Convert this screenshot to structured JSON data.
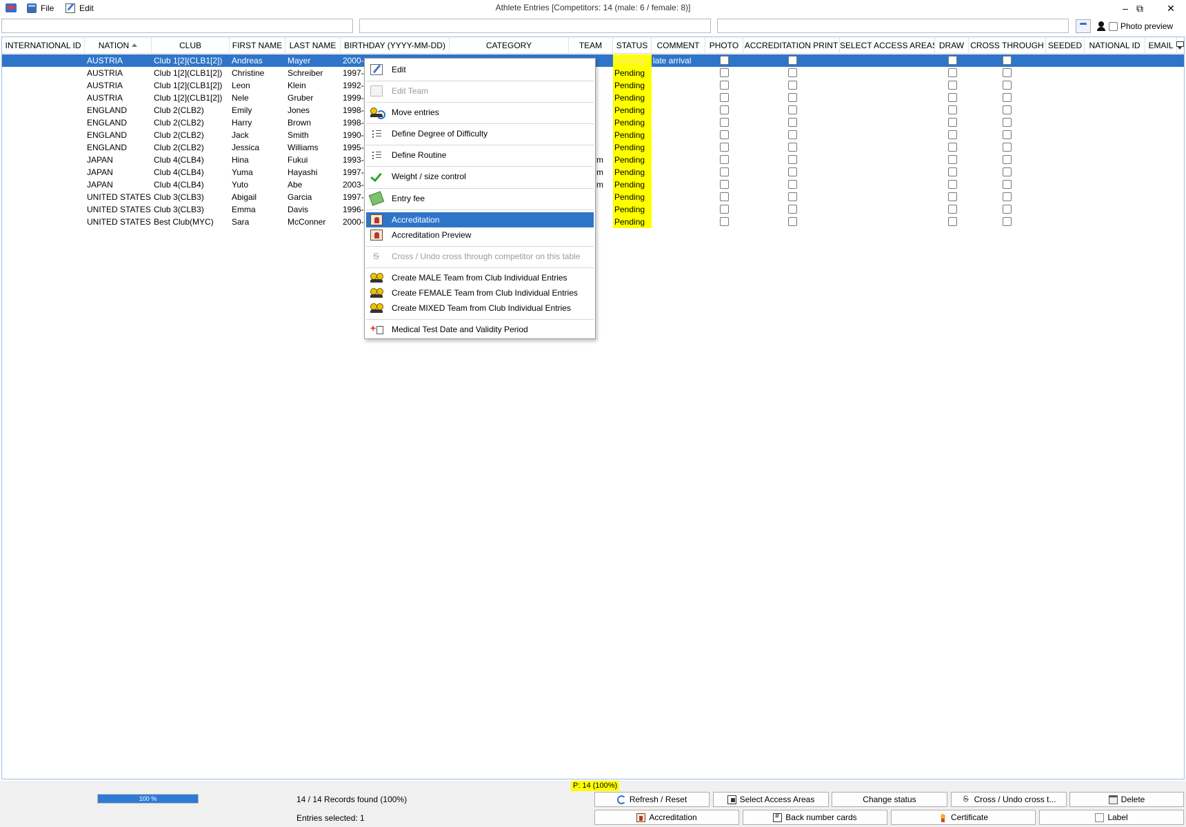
{
  "window": {
    "title": "Athlete Entries [Competitors: 14 (male: 6 / female: 8)]",
    "controls": [
      "–",
      "⧉",
      "✕"
    ]
  },
  "menu": {
    "file": "File",
    "edit": "Edit"
  },
  "toolbar": {
    "photo_preview": "Photo preview"
  },
  "table": {
    "headers": [
      "INTERNATIONAL ID",
      "NATION",
      "CLUB",
      "FIRST NAME",
      "LAST NAME",
      "BIRTHDAY (YYYY-MM-DD)",
      "CATEGORY",
      "TEAM",
      "STATUS",
      "COMMENT",
      "PHOTO",
      "ACCREDITATION PRINT",
      "SELECT ACCESS AREAS",
      "DRAW",
      "CROSS THROUGH",
      "SEEDED",
      "NATIONAL ID",
      "EMAIL"
    ],
    "rows": [
      {
        "nation": "AUSTRIA",
        "club": "Club 1[2](CLB1[2])",
        "first": "Andreas",
        "last": "Mayer",
        "birthday": "2000-",
        "team": "",
        "status": "Pending",
        "comment": "late arrival"
      },
      {
        "nation": "AUSTRIA",
        "club": "Club 1[2](CLB1[2])",
        "first": "Christine",
        "last": "Schreiber",
        "birthday": "1997-0",
        "team": "",
        "status": "Pending",
        "comment": ""
      },
      {
        "nation": "AUSTRIA",
        "club": "Club 1[2](CLB1[2])",
        "first": "Leon",
        "last": "Klein",
        "birthday": "1992-0",
        "team": "",
        "status": "Pending",
        "comment": ""
      },
      {
        "nation": "AUSTRIA",
        "club": "Club 1[2](CLB1[2])",
        "first": "Nele",
        "last": "Gruber",
        "birthday": "1999-0",
        "team": "",
        "status": "Pending",
        "comment": ""
      },
      {
        "nation": "ENGLAND",
        "club": "Club 2(CLB2)",
        "first": "Emily",
        "last": "Jones",
        "birthday": "1998-1",
        "team": "",
        "status": "Pending",
        "comment": ""
      },
      {
        "nation": "ENGLAND",
        "club": "Club 2(CLB2)",
        "first": "Harry",
        "last": "Brown",
        "birthday": "1998-1",
        "team": "",
        "status": "Pending",
        "comment": ""
      },
      {
        "nation": "ENGLAND",
        "club": "Club 2(CLB2)",
        "first": "Jack",
        "last": "Smith",
        "birthday": "1990-0",
        "team": "",
        "status": "Pending",
        "comment": ""
      },
      {
        "nation": "ENGLAND",
        "club": "Club 2(CLB2)",
        "first": "Jessica",
        "last": "Williams",
        "birthday": "1995-0",
        "team": "",
        "status": "Pending",
        "comment": ""
      },
      {
        "nation": "JAPAN",
        "club": "Club 4(CLB4)",
        "first": "Hina",
        "last": "Fukui",
        "birthday": "1993-0",
        "team": "m",
        "status": "Pending",
        "comment": ""
      },
      {
        "nation": "JAPAN",
        "club": "Club 4(CLB4)",
        "first": "Yuma",
        "last": "Hayashi",
        "birthday": "1997-1",
        "team": "m",
        "status": "Pending",
        "comment": ""
      },
      {
        "nation": "JAPAN",
        "club": "Club 4(CLB4)",
        "first": "Yuto",
        "last": "Abe",
        "birthday": "2003-0",
        "team": "m",
        "status": "Pending",
        "comment": ""
      },
      {
        "nation": "UNITED STATES",
        "club": "Club 3(CLB3)",
        "first": "Abigail",
        "last": "Garcia",
        "birthday": "1997-0",
        "team": "",
        "status": "Pending",
        "comment": ""
      },
      {
        "nation": "UNITED STATES",
        "club": "Club 3(CLB3)",
        "first": "Emma",
        "last": "Davis",
        "birthday": "1996-1",
        "team": "",
        "status": "Pending",
        "comment": ""
      },
      {
        "nation": "UNITED STATES",
        "club": "Best Club(MYC)",
        "first": "Sara",
        "last": "McConner",
        "birthday": "2000-0",
        "team": "",
        "status": "Pending",
        "comment": ""
      }
    ]
  },
  "context_menu": {
    "items": [
      {
        "label": "Edit",
        "icon": "edit-icon",
        "state": "normal"
      },
      {
        "label": "Edit Team",
        "icon": "edit-team-icon",
        "state": "disabled"
      },
      {
        "label": "Move entries",
        "icon": "move-entries-icon",
        "state": "normal"
      },
      {
        "label": "Define Degree of Difficulty",
        "icon": "list-icon",
        "state": "normal"
      },
      {
        "label": "Define Routine",
        "icon": "list-icon",
        "state": "normal"
      },
      {
        "label": "Weight / size control",
        "icon": "checkmark-icon",
        "state": "normal"
      },
      {
        "label": "Entry fee",
        "icon": "money-icon",
        "state": "normal"
      },
      {
        "label": "Accreditation",
        "icon": "badge-icon",
        "state": "highlighted"
      },
      {
        "label": "Accreditation Preview",
        "icon": "badge-icon",
        "state": "normal"
      },
      {
        "label": "Cross / Undo cross through competitor on this table",
        "icon": "strikethrough-icon",
        "state": "disabled"
      },
      {
        "label": "Create MALE Team from Club Individual Entries",
        "icon": "team-icon",
        "state": "normal"
      },
      {
        "label": "Create FEMALE Team from Club Individual Entries",
        "icon": "team-icon",
        "state": "normal"
      },
      {
        "label": "Create MIXED Team from Club Individual Entries",
        "icon": "team-icon",
        "state": "normal"
      },
      {
        "label": "Medical Test Date and Validity Period",
        "icon": "medical-icon",
        "state": "normal"
      }
    ]
  },
  "footer": {
    "percent_badge": "P: 14 (100%)",
    "progress_label": "100 %",
    "progress_value": 100,
    "records_found": "14 / 14 Records found (100%)",
    "entries_selected": "Entries selected: 1",
    "buttons_row1": [
      "Refresh / Reset",
      "Select Access Areas",
      "Change status",
      "Cross / Undo cross t...",
      "Delete"
    ],
    "buttons_row2": [
      "Accreditation",
      "Back number cards",
      "Certificate",
      "Label"
    ]
  },
  "colors": {
    "selection": "#2e75c9",
    "status_highlight": "#ffff00",
    "progress_fill": "#2e7bd6"
  }
}
